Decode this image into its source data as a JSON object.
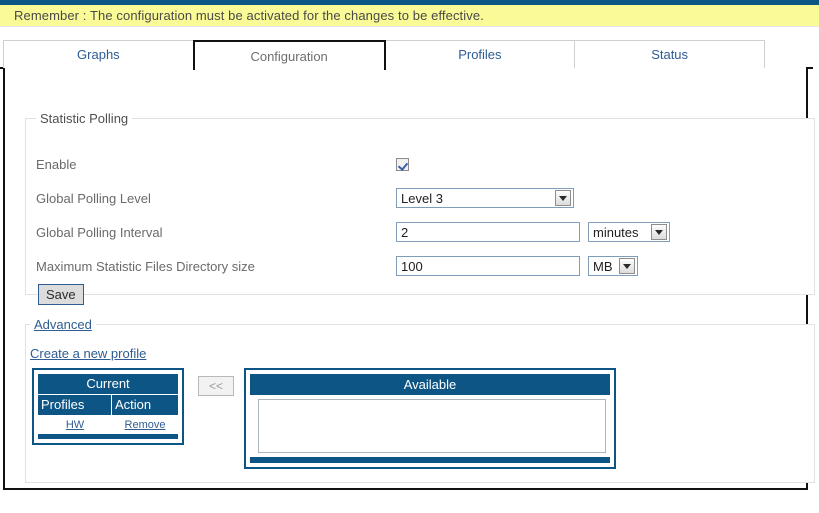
{
  "banner": {
    "message": "Remember : The configuration must be activated for the changes to be effective."
  },
  "tabs": [
    {
      "label": "Graphs",
      "active": false
    },
    {
      "label": "Configuration",
      "active": true
    },
    {
      "label": "Profiles",
      "active": false
    },
    {
      "label": "Status",
      "active": false
    }
  ],
  "statistic_polling": {
    "legend": "Statistic Polling",
    "fields": {
      "enable": {
        "label": "Enable",
        "checked": true
      },
      "global_polling_level": {
        "label": "Global Polling Level",
        "value": "Level 3"
      },
      "global_polling_interval": {
        "label": "Global Polling Interval",
        "value": "2",
        "unit": "minutes"
      },
      "max_statistic_dir_size": {
        "label": "Maximum Statistic Files Directory size",
        "value": "100",
        "unit": "MB"
      }
    },
    "save_label": "Save"
  },
  "advanced": {
    "legend": "Advanced",
    "create_profile_link": "Create a new profile",
    "current": {
      "title": "Current",
      "columns": [
        "Profiles",
        "Action"
      ],
      "rows": [
        {
          "profile": "HW",
          "action": "Remove"
        }
      ]
    },
    "move_button_label": "<<",
    "available": {
      "title": "Available",
      "items": []
    }
  },
  "colors": {
    "navy": "#0d5585",
    "banner_yellow": "#fafa96",
    "link_blue": "#2f5c91"
  }
}
